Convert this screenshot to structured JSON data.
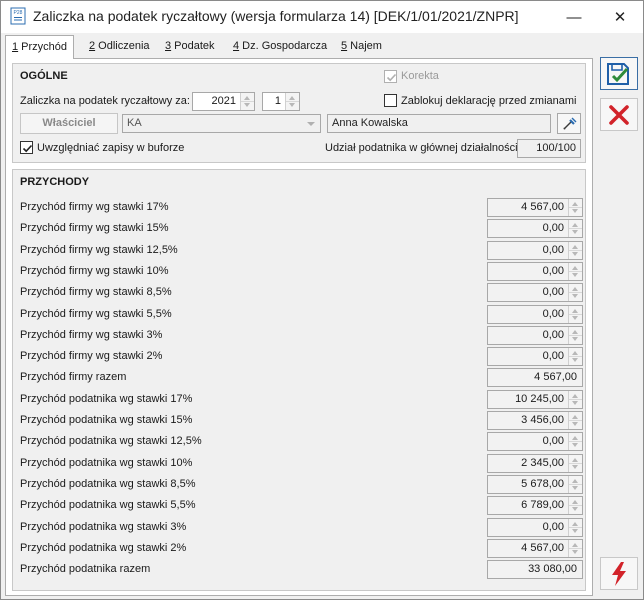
{
  "window": {
    "title": "Zaliczka na podatek ryczałtowy (wersja formularza 14) [DEK/1/01/2021/ZNPR]",
    "app_icon_label": "P28",
    "minimize_glyph": "—",
    "close_glyph": "✕"
  },
  "tabs": [
    {
      "num": "1",
      "label": " Przychód",
      "active": true
    },
    {
      "num": "2",
      "label": " Odliczenia",
      "active": false
    },
    {
      "num": "3",
      "label": " Podatek",
      "active": false
    },
    {
      "num": "4",
      "label": " Dz. Gospodarcza",
      "active": false
    },
    {
      "num": "5",
      "label": " Najem",
      "active": false
    }
  ],
  "ogolne": {
    "title": "OGÓLNE",
    "korekta_label": "Korekta",
    "korekta_checked": true,
    "zaliczka_label": "Zaliczka na podatek ryczałtowy za:",
    "year": "2021",
    "month": "1",
    "zablokuj_label": "Zablokuj deklarację przed zmianami",
    "zablokuj_checked": false,
    "owner_button": "Właściciel",
    "owner_code": "KA",
    "owner_name": "Anna Kowalska",
    "uwzgledniac_label": "Uwzględniać zapisy w buforze",
    "uwzgledniac_checked": true,
    "udzial_label": "Udział podatnika w głównej działalności",
    "udzial_value": "100/100"
  },
  "przychody": {
    "title": "PRZYCHODY",
    "rows": [
      {
        "label": "Przychód firmy wg stawki 17%",
        "value": "4 567,00",
        "spinner": true
      },
      {
        "label": "Przychód firmy wg stawki 15%",
        "value": "0,00",
        "spinner": true
      },
      {
        "label": "Przychód firmy wg stawki 12,5%",
        "value": "0,00",
        "spinner": true
      },
      {
        "label": "Przychód firmy wg stawki 10%",
        "value": "0,00",
        "spinner": true
      },
      {
        "label": "Przychód firmy wg stawki 8,5%",
        "value": "0,00",
        "spinner": true
      },
      {
        "label": "Przychód firmy wg stawki 5,5%",
        "value": "0,00",
        "spinner": true
      },
      {
        "label": "Przychód firmy wg stawki 3%",
        "value": "0,00",
        "spinner": true
      },
      {
        "label": "Przychód firmy wg stawki 2%",
        "value": "0,00",
        "spinner": true
      },
      {
        "label": "Przychód firmy razem",
        "value": "4 567,00",
        "spinner": false
      },
      {
        "label": "Przychód podatnika wg stawki 17%",
        "value": "10 245,00",
        "spinner": true
      },
      {
        "label": "Przychód podatnika wg stawki 15%",
        "value": "3 456,00",
        "spinner": true
      },
      {
        "label": "Przychód podatnika wg stawki 12,5%",
        "value": "0,00",
        "spinner": true
      },
      {
        "label": "Przychód podatnika wg stawki 10%",
        "value": "2 345,00",
        "spinner": true
      },
      {
        "label": "Przychód podatnika wg stawki 8,5%",
        "value": "5 678,00",
        "spinner": true
      },
      {
        "label": "Przychód podatnika wg stawki 5,5%",
        "value": "6 789,00",
        "spinner": true
      },
      {
        "label": "Przychód podatnika wg stawki 3%",
        "value": "0,00",
        "spinner": true
      },
      {
        "label": "Przychód podatnika wg stawki 2%",
        "value": "4 567,00",
        "spinner": true
      },
      {
        "label": "Przychód podatnika razem",
        "value": "33 080,00",
        "spinner": false
      }
    ]
  },
  "colors": {
    "accept_green": "#2e8b3a",
    "accept_blue": "#1f5fa8",
    "cancel_red": "#d2232a",
    "calc_red": "#d2232a"
  },
  "side_buttons": {
    "accept_icon": "save-accept-icon",
    "cancel_icon": "cancel-x-icon",
    "calculate_icon": "lightning-icon"
  }
}
